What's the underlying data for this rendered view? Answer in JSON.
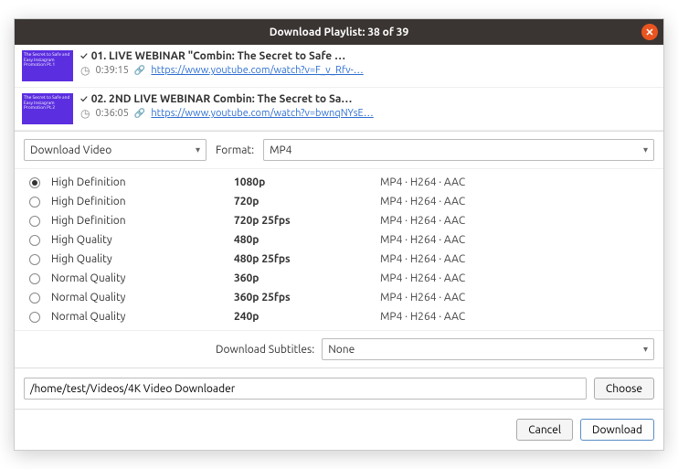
{
  "titlebar": {
    "title": "Download Playlist: 38 of 39"
  },
  "playlist": [
    {
      "check": "✓",
      "title": "01. LIVE WEBINAR \"Combin: The Secret to Safe …",
      "duration": "0:39:15",
      "url": "https://www.youtube.com/watch?v=F_v_Rfv-…",
      "thumb_text": "The Secret to Safe and Easy Instagram Promotion Pt.1"
    },
    {
      "check": "✓",
      "title": "02. 2ND LIVE WEBINAR Combin: The Secret to Sa…",
      "duration": "0:36:05",
      "url": "https://www.youtube.com/watch?v=bwnqNYsE…",
      "thumb_text": "The Secret to Safe and Easy Instagram Promotion Pt.2"
    }
  ],
  "download_mode": "Download Video",
  "format_label": "Format:",
  "format_value": "MP4",
  "qualities": [
    {
      "sel": true,
      "name": "High Definition",
      "res": "1080p",
      "codec": "MP4 · H264 · AAC"
    },
    {
      "sel": false,
      "name": "High Definition",
      "res": "720p",
      "codec": "MP4 · H264 · AAC"
    },
    {
      "sel": false,
      "name": "High Definition",
      "res": "720p 25fps",
      "codec": "MP4 · H264 · AAC"
    },
    {
      "sel": false,
      "name": "High Quality",
      "res": "480p",
      "codec": "MP4 · H264 · AAC"
    },
    {
      "sel": false,
      "name": "High Quality",
      "res": "480p 25fps",
      "codec": "MP4 · H264 · AAC"
    },
    {
      "sel": false,
      "name": "Normal Quality",
      "res": "360p",
      "codec": "MP4 · H264 · AAC"
    },
    {
      "sel": false,
      "name": "Normal Quality",
      "res": "360p 25fps",
      "codec": "MP4 · H264 · AAC"
    },
    {
      "sel": false,
      "name": "Normal Quality",
      "res": "240p",
      "codec": "MP4 · H264 · AAC"
    }
  ],
  "subtitles_label": "Download Subtitles:",
  "subtitles_value": "None",
  "path": "/home/test/Videos/4K Video Downloader",
  "choose_label": "Choose",
  "cancel_label": "Cancel",
  "download_label": "Download"
}
